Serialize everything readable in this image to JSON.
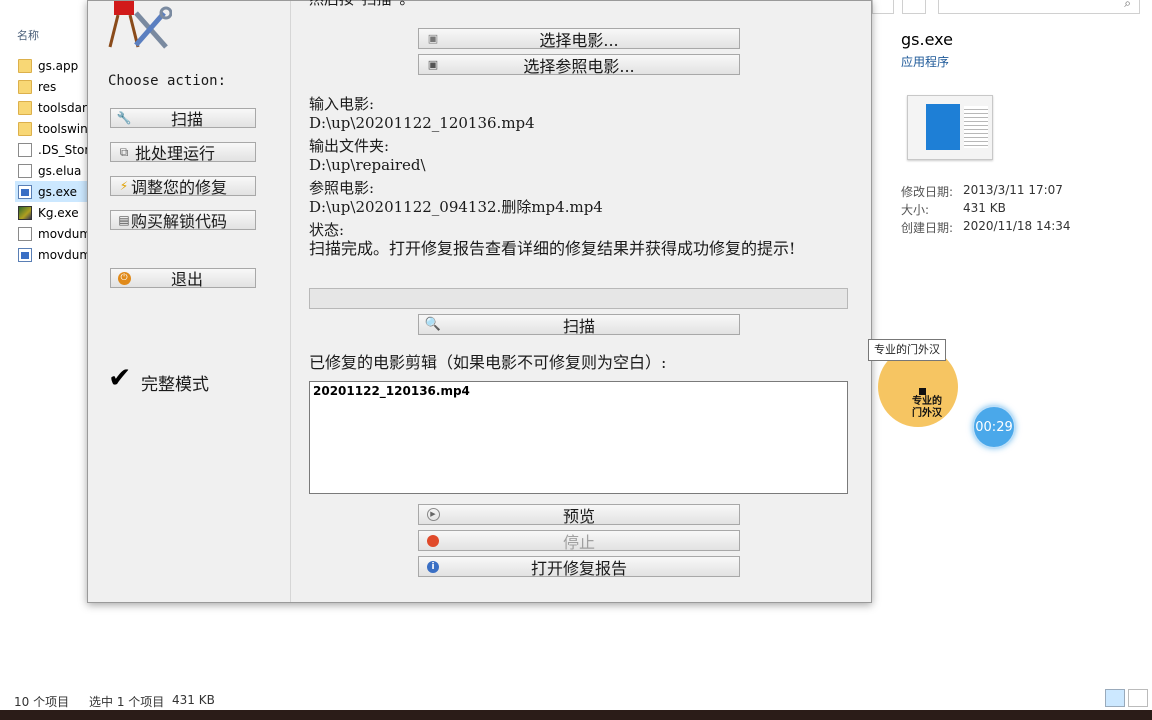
{
  "explorer": {
    "column_header": "名称",
    "files": [
      {
        "name": "gs.app",
        "type": "folder"
      },
      {
        "name": "res",
        "type": "folder"
      },
      {
        "name": "toolsdar",
        "type": "folder"
      },
      {
        "name": "toolswin",
        "type": "folder"
      },
      {
        "name": ".DS_Stor",
        "type": "file"
      },
      {
        "name": "gs.elua",
        "type": "file"
      },
      {
        "name": "gs.exe",
        "type": "exe",
        "selected": true
      },
      {
        "name": "Kg.exe",
        "type": "game"
      },
      {
        "name": "movdum",
        "type": "file"
      },
      {
        "name": "movdum",
        "type": "exe"
      }
    ],
    "details": {
      "name": "gs.exe",
      "type": "应用程序",
      "modified_label": "修改日期:",
      "modified_value": "2013/3/11 17:07",
      "size_label": "大小:",
      "size_value": "431 KB",
      "created_label": "创建日期:",
      "created_value": "2020/11/18 14:34"
    },
    "status": {
      "count": "10 个项目",
      "selected": "选中 1 个项目",
      "size": "431 KB"
    }
  },
  "app": {
    "top_instruction": "然后按“扫描”。",
    "choose_action": "Choose action:",
    "side_buttons": {
      "scan": "扫描",
      "batch": "批处理运行",
      "adjust": "调整您的修复",
      "buy": "购买解锁代码",
      "exit": "退出"
    },
    "full_mode": "完整模式",
    "select_movie": "选择电影...",
    "select_reference": "选择参照电影...",
    "input_label": "输入电影:",
    "input_value": "D:\\up\\20201122_120136.mp4",
    "output_label": "输出文件夹:",
    "output_value": "D:\\up\\repaired\\",
    "reference_label": "参照电影:",
    "reference_value": "D:\\up\\20201122_094132.删除mp4.mp4",
    "status_label": "状态:",
    "status_value": "扫描完成。打开修复报告查看详细的修复结果并获得成功修复的提示!",
    "scan_button": "扫描",
    "repaired_label": "已修复的电影剪辑（如果电影不可修复则为空白）:",
    "repaired_items": [
      "20201122_120136.mp4"
    ],
    "preview_button": "预览",
    "stop_button": "停止",
    "report_button": "打开修复报告"
  },
  "overlay": {
    "tooltip": "专业的门外汉",
    "ball_text_1": "专业的",
    "ball_text_2": "门外汉",
    "timer": "00:29"
  }
}
